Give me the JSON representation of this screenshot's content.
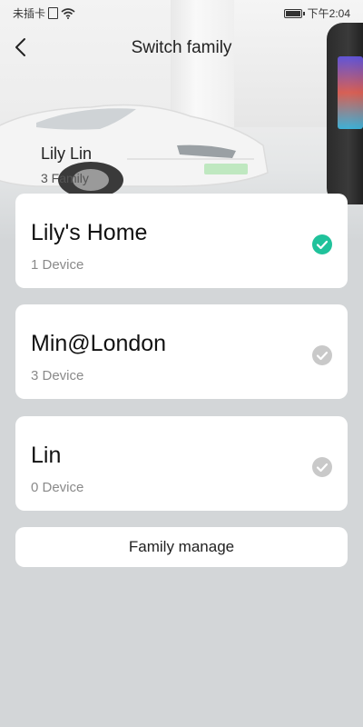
{
  "status_bar": {
    "carrier": "未插卡",
    "sim_icon": "sim-card-icon",
    "wifi_icon": "wifi-icon",
    "battery_icon": "battery-icon",
    "time": "下午2:04"
  },
  "header": {
    "back_icon": "chevron-left-icon",
    "title": "Switch family"
  },
  "user": {
    "name": "Lily Lin",
    "families": "3 Family"
  },
  "families": [
    {
      "name": "Lily's Home",
      "devices": "1 Device",
      "selected": true
    },
    {
      "name": "Min@London",
      "devices": "3 Device",
      "selected": false
    },
    {
      "name": "Lin",
      "devices": "0 Device",
      "selected": false
    }
  ],
  "actions": {
    "family_manage": "Family manage"
  },
  "colors": {
    "accent": "#20c29b",
    "inactive_check": "#c9c9c9",
    "background": "#d3d6d8"
  }
}
